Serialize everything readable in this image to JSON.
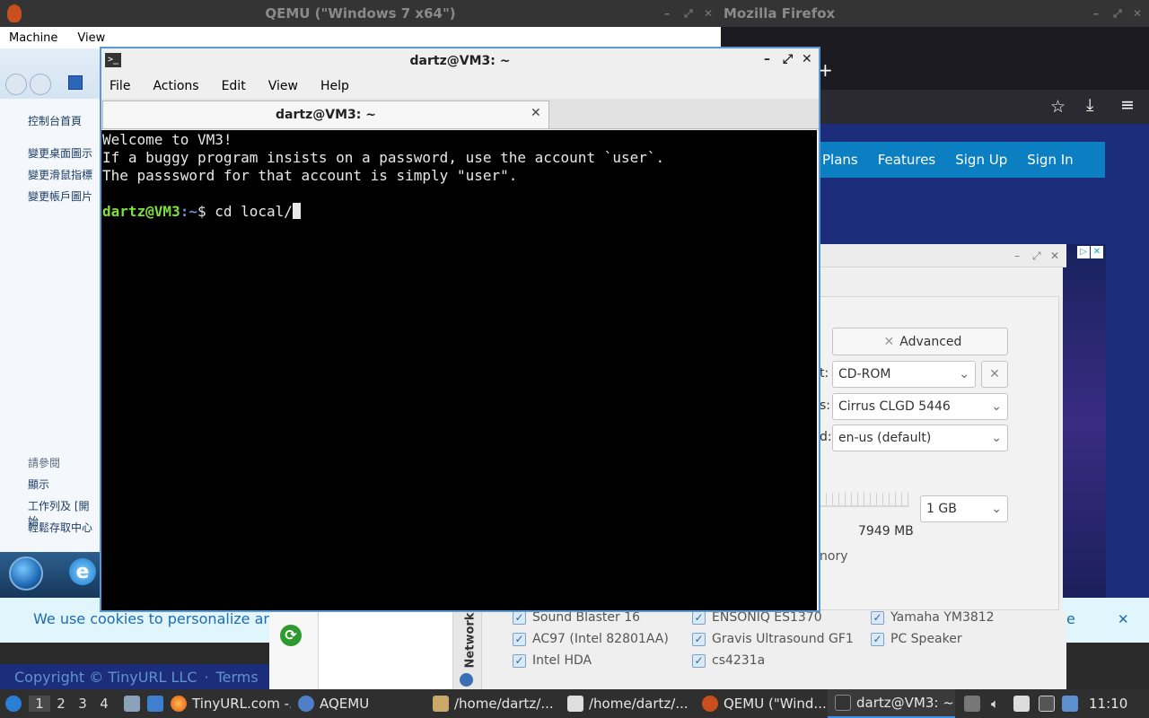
{
  "qemu_window": {
    "title": "QEMU (\"Windows 7 x64\")",
    "menu": [
      "Machine",
      "View"
    ],
    "win7_links_top": [
      "控制台首頁",
      "變更桌面圖示",
      "變更滑鼠指標",
      "變更帳戶圖片"
    ],
    "win7_links_bottom": [
      "請參閱",
      "顯示",
      "工作列及 [開始",
      "輕鬆存取中心"
    ]
  },
  "firefox_window": {
    "title": "Mozilla Firefox",
    "nav": [
      "Plans",
      "Features",
      "Sign Up",
      "Sign In"
    ],
    "cookie_text": "We use cookies to personalize an",
    "cookie_text_tail": "e",
    "footer_copyright": "Copyright © TinyURL LLC",
    "footer_sep": "·",
    "footer_terms": "Terms"
  },
  "aqemu_dialog": {
    "advanced_label": "Advanced",
    "boot_label_tail": "t:",
    "boot_value": "CD-ROM",
    "video_label_tail": "s:",
    "video_value": "Cirrus CLGD 5446",
    "keyboard_label_tail": "d:",
    "keyboard_value": "en-us (default)",
    "memory_value": "1 GB",
    "memory_free": "7949 MB",
    "memory_label_tail": "nory",
    "tab_label": "Network",
    "audio_cards": [
      [
        "Sound Blaster 16",
        "ENSONIQ ES1370",
        "Yamaha YM3812"
      ],
      [
        "AC97 (Intel 82801AA)",
        "Gravis Ultrasound GF1",
        "PC Speaker"
      ],
      [
        "Intel HDA",
        "cs4231a",
        ""
      ]
    ]
  },
  "terminal": {
    "title": "dartz@VM3: ~",
    "menu": [
      "File",
      "Actions",
      "Edit",
      "View",
      "Help"
    ],
    "tab_title": "dartz@VM3: ~",
    "lines": [
      "Welcome to VM3!",
      "If a buggy program insists on a password, use the account `user`.",
      "The passsword for that account is simply \"user\"."
    ],
    "prompt_user": "dartz@VM3",
    "prompt_path": ":~",
    "prompt_symbol": "$ ",
    "command": "cd local/"
  },
  "taskbar": {
    "workspaces": [
      "1",
      "2",
      "3",
      "4"
    ],
    "items": [
      {
        "label": "TinyURL.com -...",
        "icon": "firefox-icon"
      },
      {
        "label": "AQEMU",
        "icon": "aqemu-icon"
      },
      {
        "label": "/home/dartz/...",
        "icon": "folder-icon"
      },
      {
        "label": "/home/dartz/...",
        "icon": "editor-icon"
      },
      {
        "label": "QEMU (\"Wind...",
        "icon": "qemu-icon"
      },
      {
        "label": "dartz@VM3: ~",
        "icon": "terminal-icon"
      }
    ],
    "clock": "11:10"
  },
  "colors": {
    "terminal_prompt_user": "#7ee03a",
    "terminal_prompt_path": "#6b8fcf",
    "firefox_nav_bg": "#0b7fc1",
    "taskbar_active": "#3a8ee6"
  }
}
